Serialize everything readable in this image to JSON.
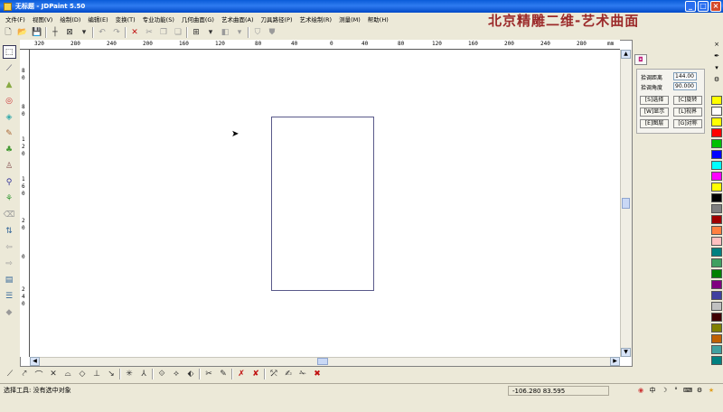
{
  "window": {
    "title": "无标题 - JDPaint 5.50",
    "min": "_",
    "max": "□",
    "close": "×"
  },
  "menu": [
    "文件(F)",
    "视图(V)",
    "绘制(D)",
    "编辑(E)",
    "变换(T)",
    "专业功能(S)",
    "几何曲面(G)",
    "艺术曲面(A)",
    "刀具路径(P)",
    "艺术绘制(R)",
    "测量(M)",
    "帮助(H)"
  ],
  "brand": "北京精雕二维-艺术曲面",
  "ruler": {
    "h_labels": [
      "320",
      "280",
      "240",
      "200",
      "160",
      "120",
      "80",
      "40",
      "0",
      "40",
      "80",
      "120",
      "160",
      "200",
      "240",
      "280",
      "320",
      "mm"
    ],
    "v_labels": [
      "8",
      "0",
      "8",
      "0",
      "1",
      "2",
      "0",
      "1",
      "6",
      "0",
      "2",
      "0",
      "0",
      "2",
      "4",
      "0"
    ]
  },
  "right_panel": {
    "distance_label": "拾调距离",
    "distance_value": "144.00",
    "angle_label": "拾调角度",
    "angle_value": "90.000",
    "buttons": [
      "[S]选择",
      "[C]旋转",
      "[W]显示",
      "[L]视界",
      "[E]图层",
      "[G]对称"
    ]
  },
  "palette": [
    "#ffff00",
    "#ffffff",
    "#ffff00",
    "#ff0000",
    "#00c000",
    "#0000ff",
    "#00ffff",
    "#ff00ff",
    "#ffff00",
    "#000000",
    "#808080",
    "#a00000",
    "#ff8040",
    "#ffc0c0",
    "#008080",
    "#40a060",
    "#008000",
    "#800080",
    "#4040a0",
    "#c0c0c0",
    "#400000",
    "#808000",
    "#c06000",
    "#40a0a0",
    "#008080"
  ],
  "status": {
    "text": "选择工具: 没有选中对象",
    "coords": "-106.280   83.595"
  }
}
